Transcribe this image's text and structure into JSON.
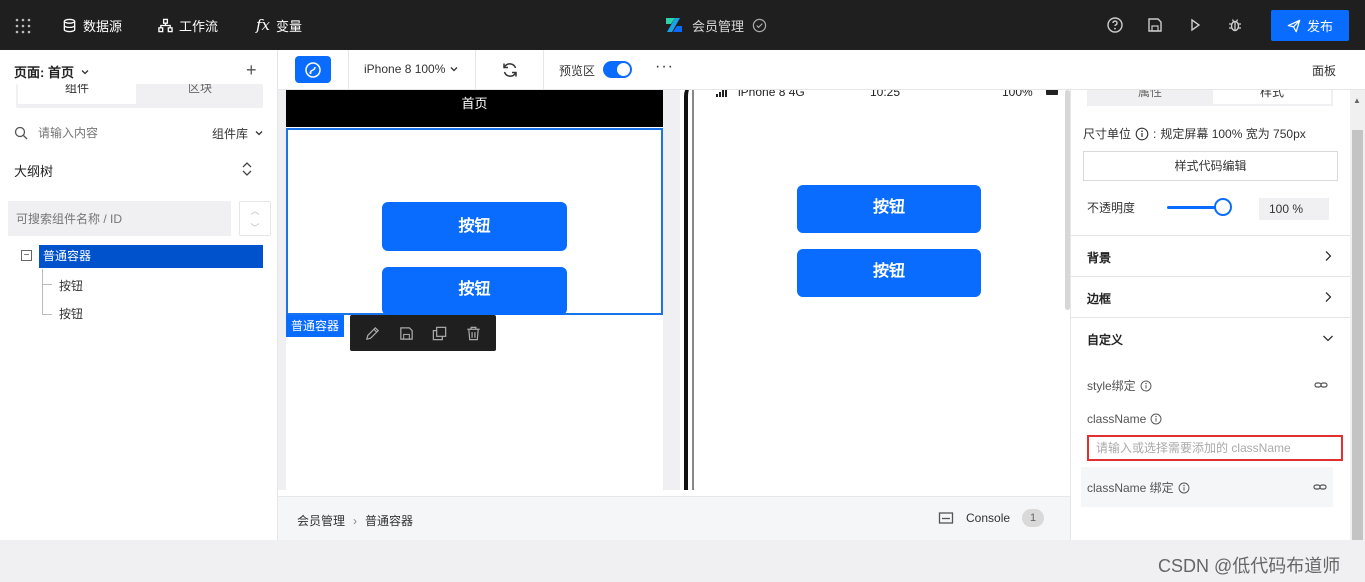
{
  "topbar": {
    "datasource": "数据源",
    "workflow": "工作流",
    "variable": "变量",
    "app_title": "会员管理",
    "publish": "发布"
  },
  "left": {
    "page_label": "页面: 首页",
    "tab_components": "组件",
    "tab_blocks": "区块",
    "search_placeholder": "请输入内容",
    "component_library": "组件库",
    "outline_title": "大纲树",
    "outline_search_placeholder": "可搜索组件名称 / ID",
    "tree": {
      "root": "普通容器",
      "children": [
        "按钮",
        "按钮"
      ]
    }
  },
  "toolbar": {
    "device": "iPhone 8 100%",
    "preview_label": "预览区",
    "more": "···",
    "panel": "面板"
  },
  "canvas": {
    "page_title": "首页",
    "button_text": "按钮",
    "selection_tag": "普通容器",
    "status_carrier": "iPhone 8  4G",
    "status_time": "10:25",
    "status_battery": "100%"
  },
  "footer": {
    "crumb_root": "会员管理",
    "crumb_current": "普通容器",
    "console": "Console",
    "console_count": "1"
  },
  "right": {
    "tab_props": "属性",
    "tab_style": "样式",
    "unit_label": "尺寸单位",
    "unit_value": "规定屏幕 100% 宽为 750px",
    "code_edit": "样式代码编辑",
    "opacity_label": "不透明度",
    "opacity_value": "100 %",
    "opacity_fraction": 1.0,
    "sections": [
      "背景",
      "边框",
      "自定义"
    ],
    "style_bind": "style绑定",
    "classname": "className",
    "classname_placeholder": "请输入或选择需要添加的 className",
    "classname_bind": "className 绑定"
  },
  "watermark": "CSDN @低代码布道师"
}
